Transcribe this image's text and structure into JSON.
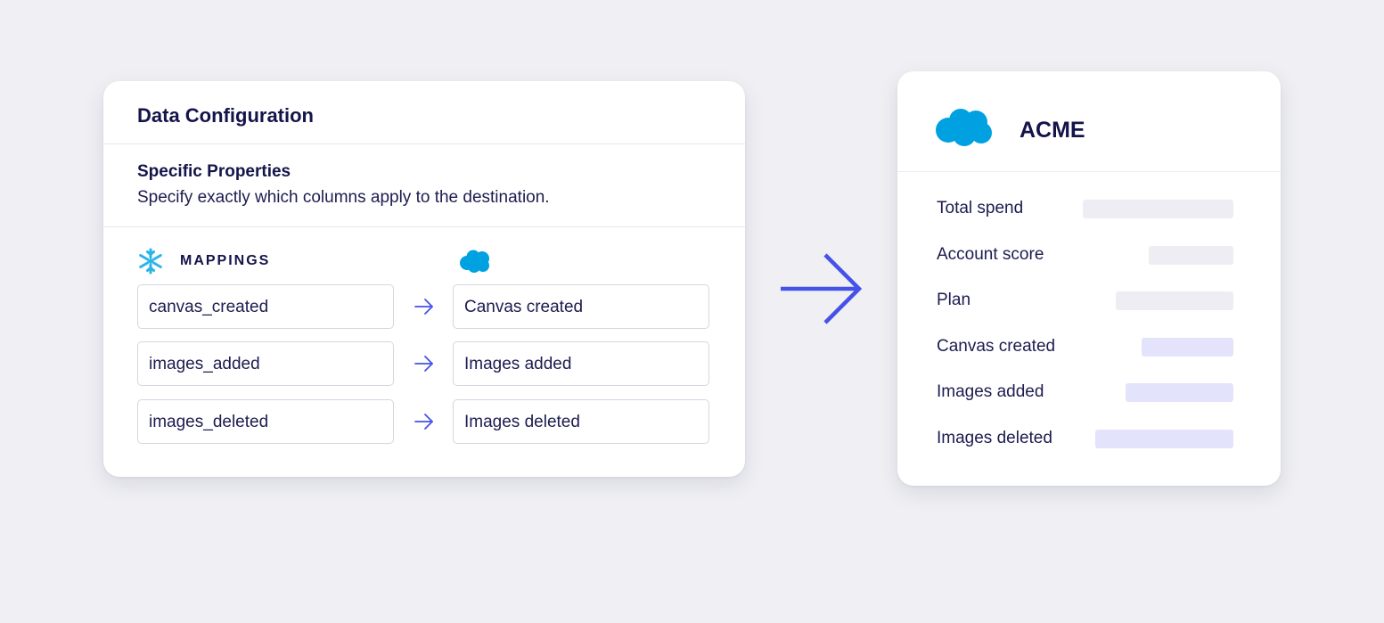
{
  "config": {
    "title": "Data Configuration",
    "section_title": "Specific Properties",
    "section_desc": "Specify exactly which columns apply to the destination.",
    "mappings_label": "MAPPINGS",
    "rows": [
      {
        "source": "canvas_created",
        "dest": "Canvas created"
      },
      {
        "source": "images_added",
        "dest": "Images added"
      },
      {
        "source": "images_deleted",
        "dest": "Images deleted"
      }
    ]
  },
  "account": {
    "name": "ACME",
    "properties": [
      {
        "label": "Total spend"
      },
      {
        "label": "Account score"
      },
      {
        "label": "Plan"
      },
      {
        "label": "Canvas created"
      },
      {
        "label": "Images added"
      },
      {
        "label": "Images deleted"
      }
    ]
  },
  "colors": {
    "accent": "#4452e8",
    "snowflake": "#29b5e8",
    "salesforce": "#00a1e0",
    "text": "#14144a",
    "bar_gray": "#ededf3",
    "bar_blue": "#e3e3fb"
  },
  "icons": {
    "source": "snowflake-icon",
    "destination": "salesforce-cloud-icon",
    "flow": "arrow-right-icon"
  }
}
